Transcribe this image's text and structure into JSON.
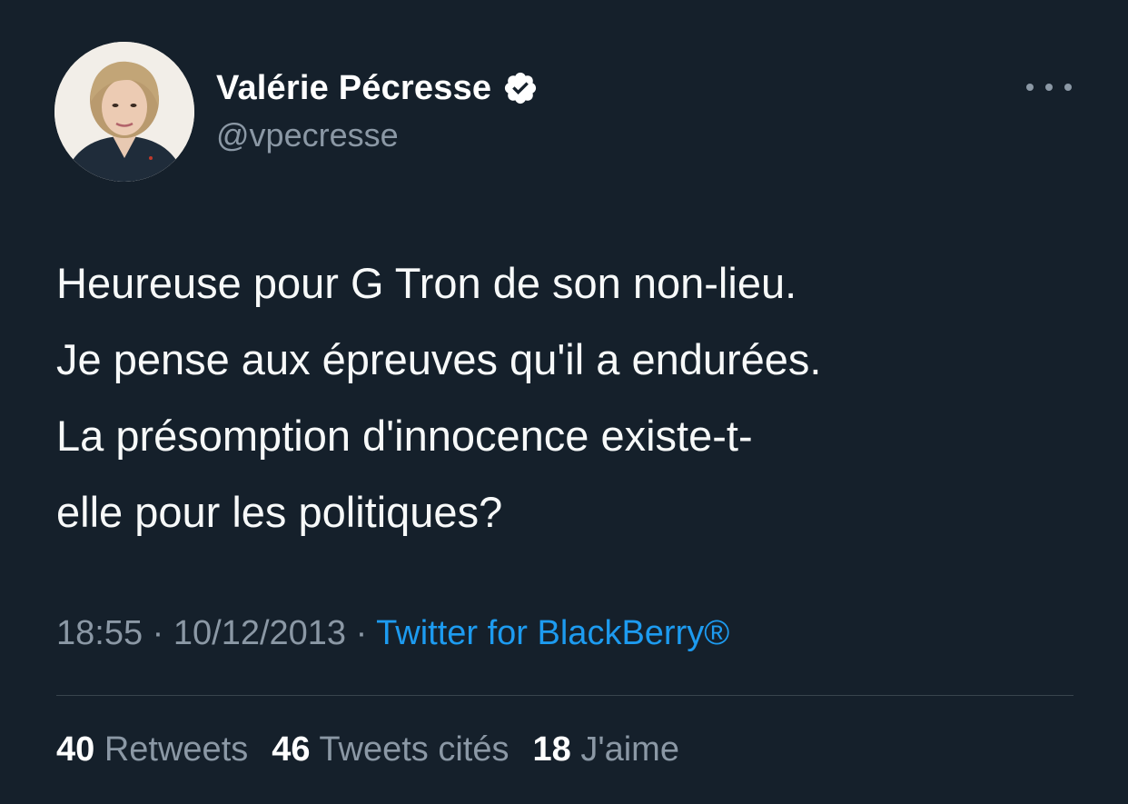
{
  "author": {
    "display_name": "Valérie Pécresse",
    "handle": "@vpecresse",
    "verified": true,
    "avatar_icon": "profile-photo"
  },
  "tweet": {
    "text_lines": [
      "Heureuse pour G Tron de son non-lieu.",
      "Je pense aux épreuves qu'il a endurées.",
      "La présomption d'innocence existe-t-",
      "elle pour les politiques?"
    ],
    "time": "18:55",
    "separator": "·",
    "date": "10/12/2013",
    "source": "Twitter for BlackBerry®"
  },
  "stats": {
    "retweets": {
      "count": "40",
      "label": "Retweets"
    },
    "quotes": {
      "count": "46",
      "label": "Tweets cités"
    },
    "likes": {
      "count": "18",
      "label": "J'aime"
    }
  },
  "colors": {
    "background": "#15202b",
    "text": "#f7f9f9",
    "secondary": "#8b98a5",
    "link": "#1d9bf0",
    "divider": "#38444d"
  }
}
